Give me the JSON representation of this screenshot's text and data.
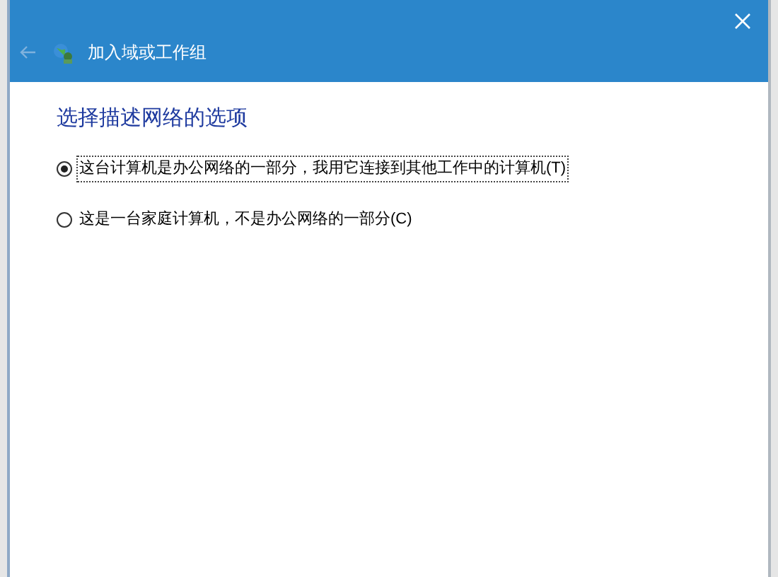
{
  "window": {
    "title": "加入域或工作组"
  },
  "heading": "选择描述网络的选项",
  "options": [
    {
      "label": "这台计算机是办公网络的一部分，我用它连接到其他工作中的计算机(T)",
      "selected": true
    },
    {
      "label": "这是一台家庭计算机，不是办公网络的一部分(C)",
      "selected": false
    }
  ]
}
